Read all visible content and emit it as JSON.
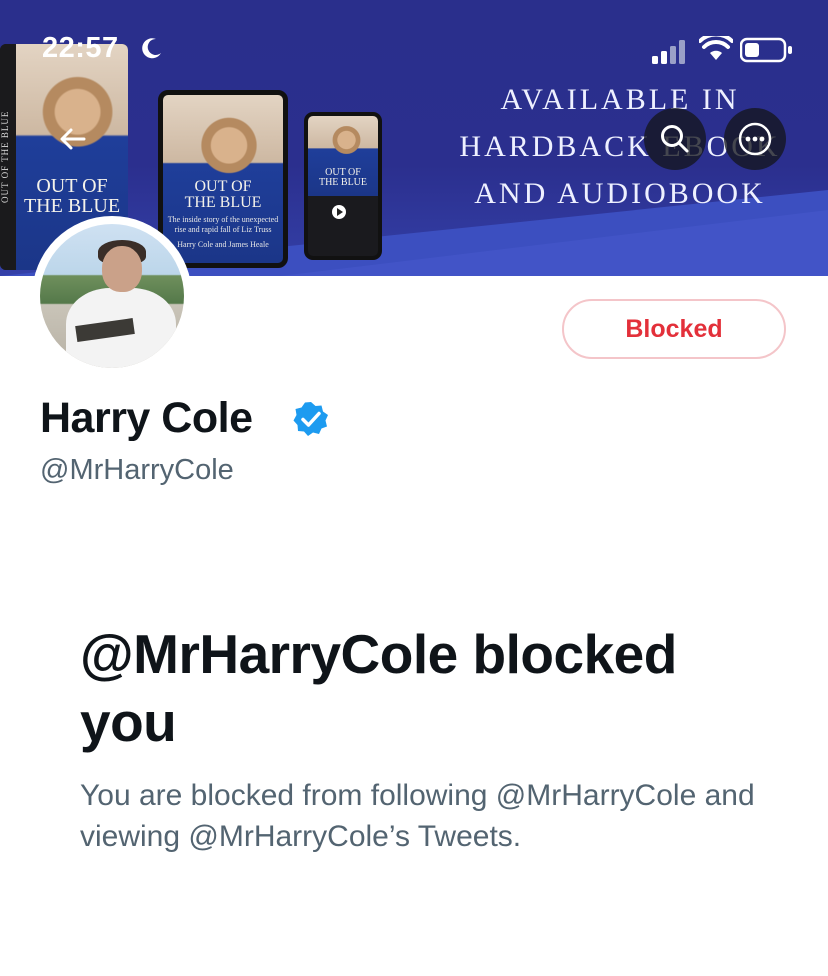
{
  "status_bar": {
    "time": "22:57",
    "icons": [
      "moon-icon",
      "signal-icon",
      "wifi-icon",
      "battery-icon"
    ]
  },
  "banner": {
    "promo_lines": [
      "AVAILABLE IN",
      "HARDBACK EBOOK",
      "AND AUDIOBOOK"
    ],
    "book": {
      "title_line1": "OUT OF",
      "title_line2": "THE BLUE",
      "subtitle": "The inside story of the unexpected rise and rapid fall of Liz Truss",
      "authors": "Harry Cole and James Heale",
      "spine": "OUT OF THE BLUE"
    },
    "colors": {
      "background": "#2b2f8e",
      "accent": "#3440a8"
    }
  },
  "header_buttons": {
    "back": "arrow-left-icon",
    "search": "search-icon",
    "more": "more-icon"
  },
  "profile": {
    "name": "Harry Cole",
    "handle": "@MrHarryCole",
    "verified": true,
    "blocked_button_label": "Blocked"
  },
  "blocked_notice": {
    "headline": "@MrHarryCole blocked you",
    "body": "You are blocked from following @MrHarryCole and viewing @MrHarryCole’s Tweets."
  },
  "colors": {
    "text_primary": "#0f1419",
    "text_secondary": "#536471",
    "blocked_red": "#e3303a",
    "verified_blue": "#1d9bf0"
  }
}
